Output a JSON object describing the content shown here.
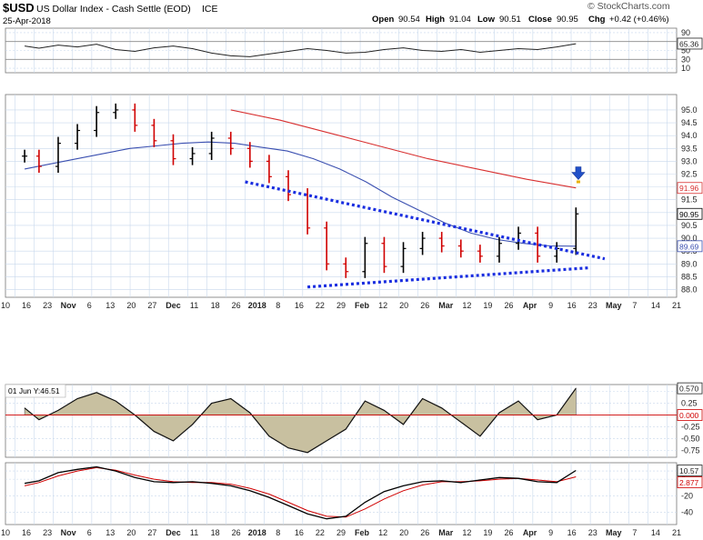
{
  "header": {
    "symbol": "$USD",
    "name": "US Dollar Index - Cash Settle (EOD)",
    "exchange": "ICE",
    "date": "25-Apr-2018",
    "open_label": "Open",
    "open": "90.54",
    "high_label": "High",
    "high": "91.04",
    "low_label": "Low",
    "low": "90.51",
    "close_label": "Close",
    "close": "90.95",
    "chg_label": "Chg",
    "chg": "+0.42 (+0.46%)",
    "watermark": "© StockCharts.com"
  },
  "colors": {
    "up": "#000000",
    "down": "#d00000",
    "ma_fast": "#3a4fb0",
    "ma_slow": "#d83030",
    "trendline": "#1a2ee0",
    "hist_fill": "#c8c0a0",
    "grid": "#c8d8ec",
    "signal": "#d00000",
    "arrow": "#2050c8"
  },
  "icons": {
    "signal_arrow": "down-arrow-icon"
  },
  "chart_data": [
    {
      "type": "line",
      "panel": "indicator-top",
      "yticks": [
        "90",
        "70",
        "50",
        "30",
        "10"
      ],
      "ylim": [
        0,
        100
      ],
      "levels": [
        70,
        30
      ],
      "current_value": "65.36",
      "current_value_label": "65.36",
      "x_values": [
        9,
        12,
        16,
        20,
        24,
        28,
        32,
        36,
        40,
        44,
        48,
        52,
        56,
        60,
        64,
        68,
        72,
        76,
        80,
        84,
        88,
        92,
        96,
        100,
        104,
        108,
        112,
        116,
        120,
        124
      ],
      "values": [
        60,
        55,
        62,
        58,
        64,
        52,
        48,
        56,
        60,
        54,
        44,
        38,
        36,
        42,
        48,
        54,
        50,
        44,
        46,
        52,
        56,
        50,
        48,
        52,
        46,
        50,
        54,
        52,
        58,
        65
      ]
    },
    {
      "type": "candlestick",
      "panel": "price",
      "ylim": [
        87.7,
        95.6
      ],
      "yticks": [
        "95.0",
        "94.5",
        "94.0",
        "93.5",
        "93.0",
        "92.5",
        "92.0",
        "91.5",
        "91.0",
        "90.5",
        "90.0",
        "89.5",
        "89.0",
        "88.5",
        "88.0"
      ],
      "xticks": [
        "10",
        "16",
        "23",
        "Nov",
        "6",
        "13",
        "20",
        "27",
        "Dec",
        "11",
        "18",
        "26",
        "2018",
        "8",
        "16",
        "22",
        "29",
        "Feb",
        "12",
        "20",
        "26",
        "Mar",
        "12",
        "19",
        "26",
        "Apr",
        "9",
        "16",
        "23",
        "May",
        "7",
        "14",
        "21"
      ],
      "xticks_bold": [
        "Nov",
        "Dec",
        "2018",
        "Feb",
        "Mar",
        "Apr",
        "May"
      ],
      "price_labels": [
        {
          "text": "91.96",
          "value": 91.96,
          "color": "#d83030"
        },
        {
          "text": "90.95",
          "value": 90.95,
          "color": "#000000"
        },
        {
          "text": "89.69",
          "value": 89.69,
          "color": "#3a4fb0"
        }
      ],
      "x_values": [
        9,
        12,
        16,
        20,
        24,
        28,
        32,
        36,
        40,
        44,
        48,
        52,
        56,
        60,
        64,
        68,
        72,
        76,
        80,
        84,
        88,
        92,
        96,
        100,
        104,
        108,
        112,
        116,
        120,
        124
      ],
      "close": [
        93.2,
        92.8,
        93.7,
        94.2,
        94.9,
        95.0,
        94.4,
        93.8,
        93.1,
        93.3,
        93.9,
        93.5,
        93.0,
        92.4,
        91.7,
        90.4,
        89.0,
        88.7,
        89.8,
        88.9,
        89.6,
        90.0,
        89.7,
        89.5,
        89.3,
        89.8,
        90.2,
        89.3,
        89.6,
        90.95
      ],
      "moving_average_fast": [
        92.7,
        92.9,
        93.1,
        93.3,
        93.5,
        93.6,
        93.7,
        93.75,
        93.7,
        93.55,
        93.4,
        93.1,
        92.7,
        92.2,
        91.6,
        91.1,
        90.6,
        90.2,
        89.95,
        89.8,
        89.7,
        89.69
      ],
      "moving_average_slow_start_x": 52,
      "moving_average_slow": [
        95.0,
        94.6,
        94.1,
        93.6,
        93.1,
        92.7,
        92.3,
        91.96
      ],
      "trendlines": [
        {
          "name": "upper",
          "from": [
            55,
            92.2
          ],
          "to": [
            130,
            89.2
          ]
        },
        {
          "name": "lower",
          "from": [
            68,
            88.1
          ],
          "to": [
            127,
            88.85
          ]
        }
      ],
      "signal_arrow_x": 124.5,
      "signal_arrow_value": 92.5
    },
    {
      "type": "area",
      "panel": "indicator-middle",
      "label": "01 Jun Y:46.51",
      "yticks": [
        "0.50",
        "0.25",
        "0.00",
        "-0.25",
        "-0.50",
        "-0.75"
      ],
      "ylim": [
        -0.9,
        0.65
      ],
      "current_value_label": "0.570",
      "zero_label": "0.000",
      "x_values": [
        9,
        12,
        16,
        20,
        24,
        28,
        32,
        36,
        40,
        44,
        48,
        52,
        56,
        60,
        64,
        68,
        72,
        76,
        80,
        84,
        88,
        92,
        96,
        100,
        104,
        108,
        112,
        116,
        120,
        124
      ],
      "values": [
        0.15,
        -0.1,
        0.1,
        0.35,
        0.48,
        0.3,
        0.0,
        -0.35,
        -0.55,
        -0.2,
        0.25,
        0.35,
        0.05,
        -0.45,
        -0.7,
        -0.8,
        -0.55,
        -0.3,
        0.3,
        0.1,
        -0.2,
        0.35,
        0.15,
        -0.15,
        -0.45,
        0.05,
        0.3,
        -0.1,
        0.0,
        0.57
      ]
    },
    {
      "type": "line",
      "panel": "indicator-bottom",
      "yticks": [
        "10",
        "0",
        "-20",
        "-40"
      ],
      "ylim": [
        -55,
        20
      ],
      "current_value_label": "10.57",
      "signal_value_label": "2.877",
      "x_values": [
        9,
        12,
        16,
        20,
        24,
        28,
        32,
        36,
        40,
        44,
        48,
        52,
        56,
        60,
        64,
        68,
        72,
        76,
        80,
        84,
        88,
        92,
        96,
        100,
        104,
        108,
        112,
        116,
        120,
        124
      ],
      "line": [
        -5,
        -2,
        8,
        12,
        15,
        10,
        2,
        -3,
        -4,
        -3,
        -5,
        -8,
        -14,
        -22,
        -32,
        -42,
        -48,
        -45,
        -28,
        -15,
        -8,
        -3,
        -2,
        -4,
        -1,
        2,
        1,
        -3,
        -4,
        10.57
      ],
      "signal": [
        -8,
        -4,
        4,
        10,
        14,
        11,
        5,
        0,
        -3,
        -4,
        -4,
        -6,
        -11,
        -18,
        -28,
        -38,
        -45,
        -46,
        -36,
        -24,
        -14,
        -7,
        -3,
        -3,
        -2,
        0,
        1,
        -1,
        -3,
        2.877
      ]
    }
  ]
}
